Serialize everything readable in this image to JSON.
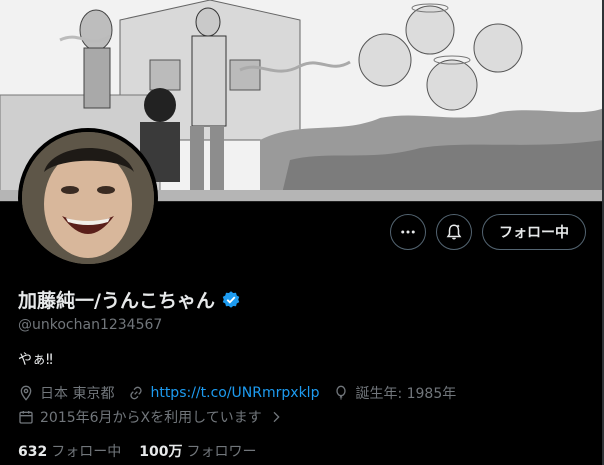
{
  "profile": {
    "display_name": "加藤純一/うんこちゃん",
    "handle": "@unkochan1234567",
    "bio": "やぁ‼",
    "location": "日本 東京都",
    "website": "https://t.co/UNRmrpxklp",
    "birth": "誕生年: 1985年",
    "joined": "2015年6月からXを利用しています"
  },
  "actions": {
    "more_icon": "more-horizontal-icon",
    "notify_icon": "bell-icon",
    "follow_label": "フォロー中"
  },
  "stats": {
    "following_count": "632",
    "following_label": "フォロー中",
    "followers_count": "100万",
    "followers_label": "フォロワー"
  },
  "colors": {
    "background": "#000000",
    "text": "#e7e9ea",
    "muted": "#71767b",
    "link": "#1d9bf0",
    "verified": "#1d9bf0",
    "border": "#536471"
  }
}
